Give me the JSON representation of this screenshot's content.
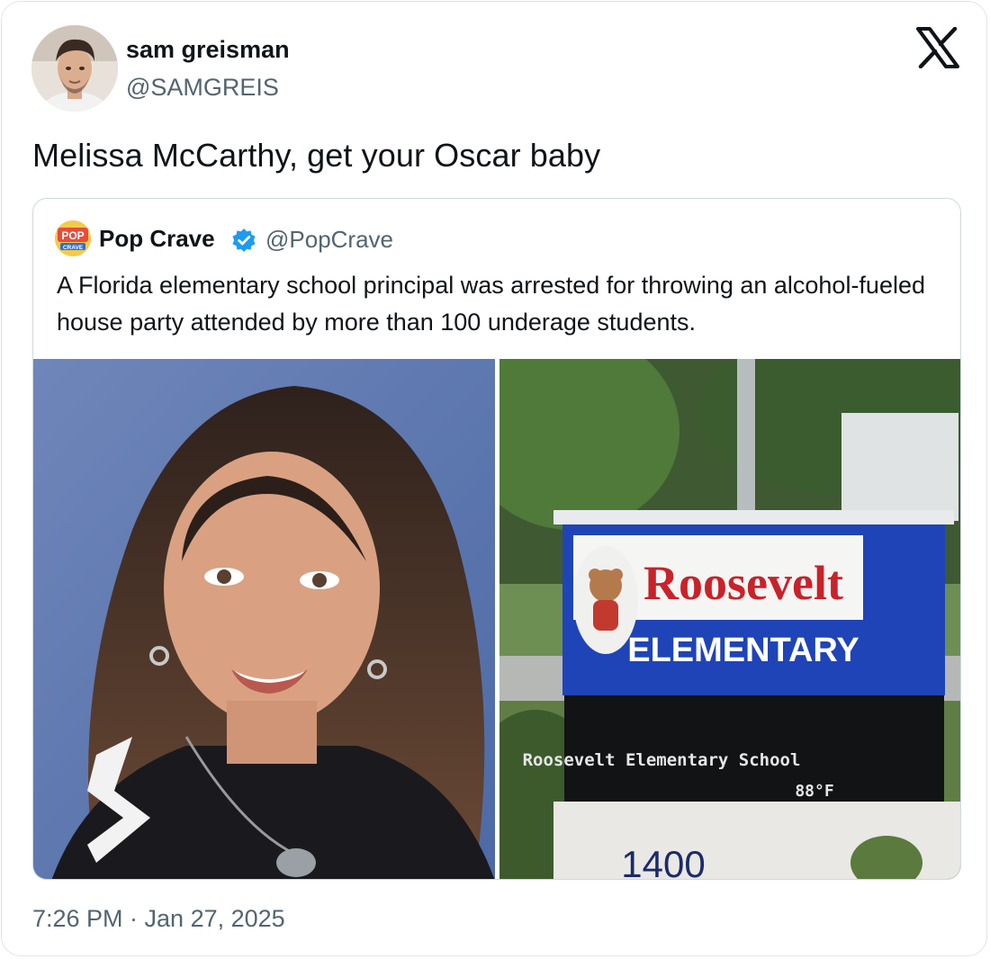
{
  "author": {
    "display_name": "sam greisman",
    "handle": "@SAMGREIS",
    "avatar_icon": "profile-photo"
  },
  "platform_icon": "x-logo-icon",
  "tweet": {
    "text": "Melissa McCarthy, get your Oscar baby",
    "timestamp": "7:26 PM · Jan 27, 2025"
  },
  "quoted": {
    "avatar_text_top": "POP",
    "avatar_text_bottom": "CRAVE",
    "display_name": "Pop Crave",
    "verified": true,
    "handle": "@PopCrave",
    "text": "A Florida elementary school principal was arrested for throwing an alcohol-fueled house party attended by more than 100 underage students.",
    "sign": {
      "name_line": "Roosevelt",
      "type_line": "ELEMENTARY",
      "marquee_text": "Roosevelt Elementary School",
      "temp": "88°F",
      "address_number": "1400"
    }
  },
  "colors": {
    "text": "#0f1419",
    "secondary": "#536471",
    "verified_blue": "#1d9bf0",
    "sign_blue": "#1f44b8",
    "sign_red": "#c8222a"
  }
}
